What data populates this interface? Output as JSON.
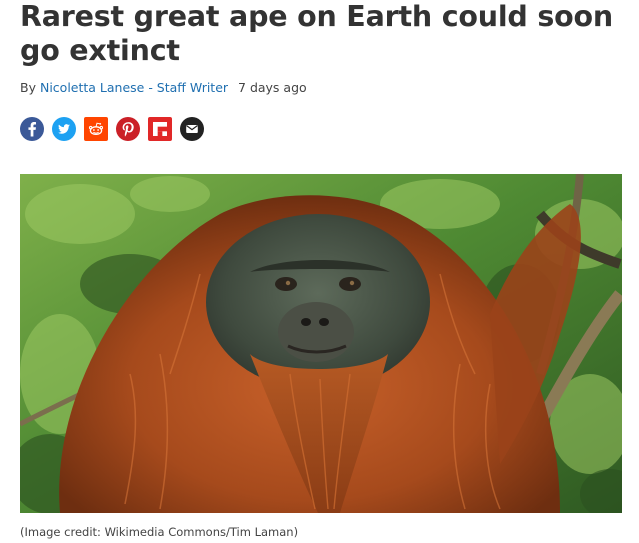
{
  "article": {
    "title": "Rarest great ape on Earth could soon go extinct",
    "byline_prefix": "By",
    "author": "Nicoletta Lanese - Staff Writer",
    "date": "7 days ago"
  },
  "share_buttons": [
    {
      "icon": "facebook-icon",
      "color": "#3b5998"
    },
    {
      "icon": "twitter-icon",
      "color": "#1da1f2"
    },
    {
      "icon": "reddit-icon",
      "color": "#ff4500"
    },
    {
      "icon": "pinterest-icon",
      "color": "#cb2027"
    },
    {
      "icon": "flipboard-icon",
      "color": "#e12828"
    },
    {
      "icon": "email-icon",
      "color": "#222222"
    }
  ],
  "image": {
    "caption": "(Image credit: Wikimedia Commons/Tim Laman)"
  }
}
